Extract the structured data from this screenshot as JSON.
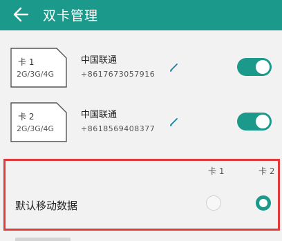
{
  "header": {
    "title": "双卡管理",
    "background_color": "#1b9a8c"
  },
  "sims": [
    {
      "card_label": "卡 1",
      "card_types": "2G/3G/4G",
      "carrier": "中国联通",
      "phone": "+8617673057916",
      "enabled": true
    },
    {
      "card_label": "卡 2",
      "card_types": "2G/3G/4G",
      "carrier": "中国联通",
      "phone": "+8618569408377",
      "enabled": true
    }
  ],
  "default_data": {
    "label": "默认移动数据",
    "columns": [
      "卡 1",
      "卡 2"
    ],
    "selected": "卡 2",
    "highlight_color": "#e23a3a"
  },
  "icons": {
    "back": "back-arrow-icon",
    "edit": "pencil-edit-icon",
    "sim": "sim-card-icon"
  },
  "accent_color": "#1b9a8c"
}
